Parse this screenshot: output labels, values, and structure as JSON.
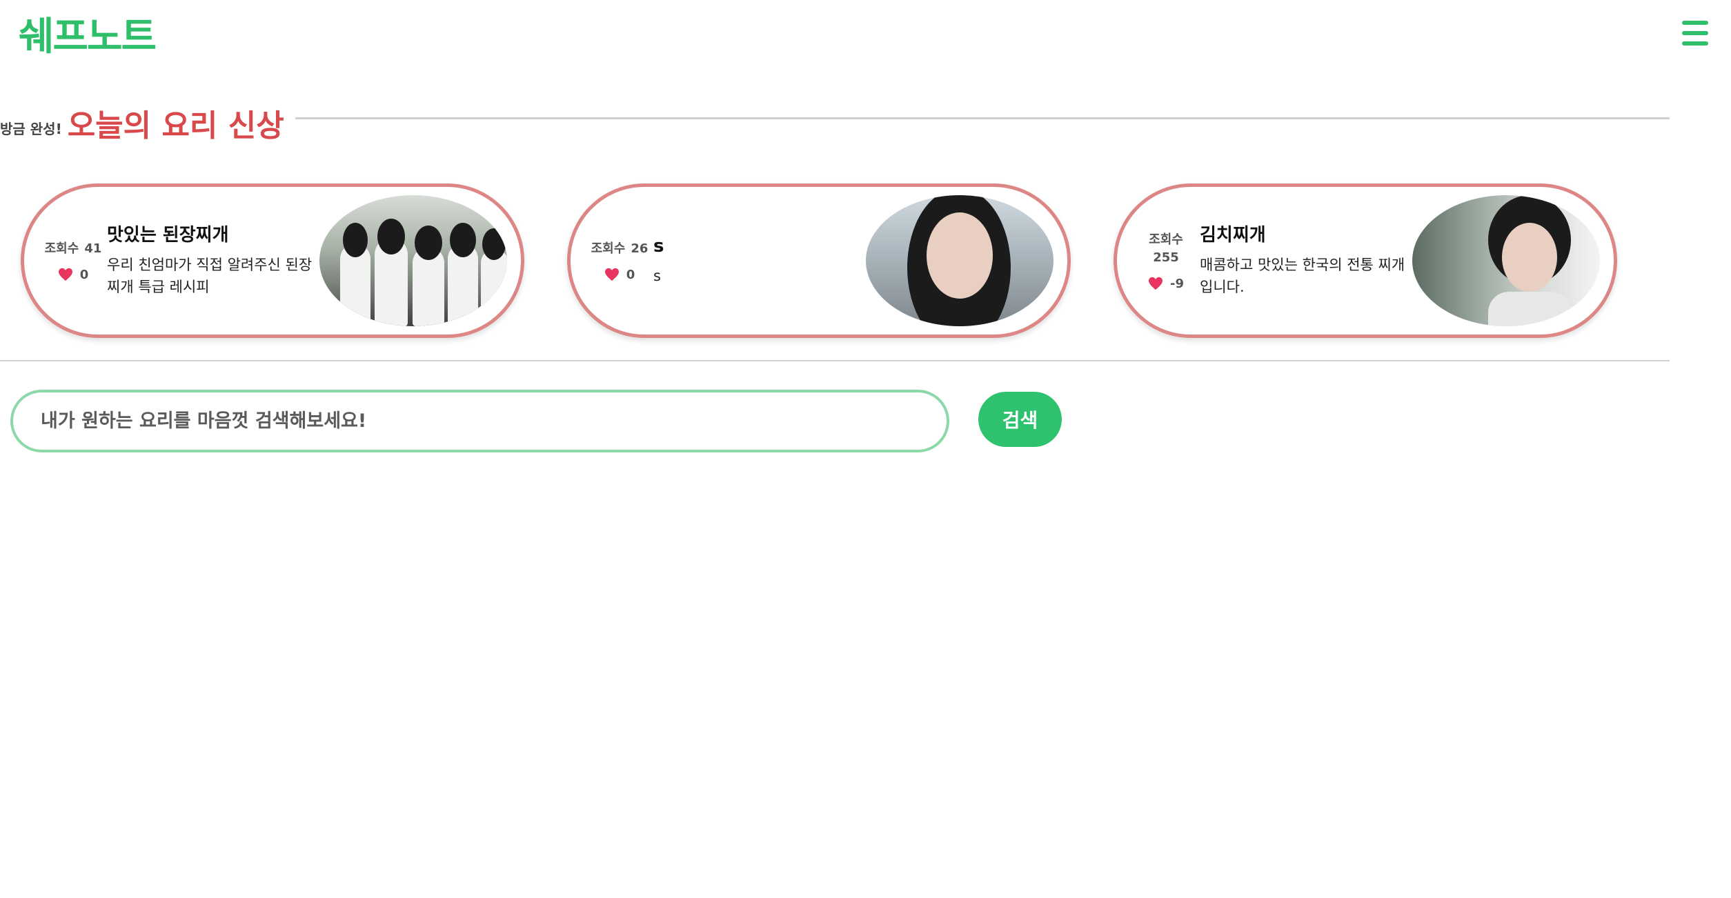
{
  "header": {
    "logo": "쉐프노트",
    "menu_icon": "hamburger-icon"
  },
  "section": {
    "subtitle": "방금 완성!",
    "title": "오늘의 요리 신상"
  },
  "colors": {
    "brand": "#2fbf6a",
    "accent": "#d9484a",
    "card_border": "#dc8686",
    "heart": "#e8345f"
  },
  "cards": [
    {
      "views_label": "조회수",
      "views": "41",
      "likes": "0",
      "title": "맛있는 된장찌개",
      "description": "우리 친엄마가 직접 알려주신 된장찌개 특급 레시피",
      "image_icon": "recipe-photo"
    },
    {
      "views_label": "조회수",
      "views": "26",
      "likes": "0",
      "title": "s",
      "description": "s",
      "image_icon": "recipe-photo"
    },
    {
      "views_label": "조회수",
      "views": "255",
      "likes": "-9",
      "title": "김치찌개",
      "description": "매콤하고 맛있는 한국의 전통 찌개입니다.",
      "image_icon": "recipe-photo"
    }
  ],
  "search": {
    "placeholder": "내가 원하는 요리를 마음껏 검색해보세요!",
    "value": "",
    "button_label": "검색"
  }
}
